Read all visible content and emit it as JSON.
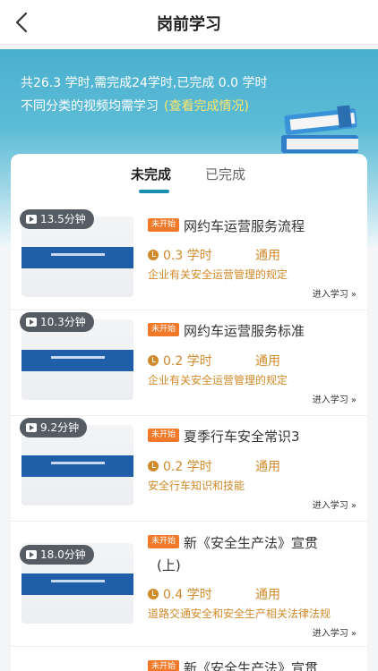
{
  "nav": {
    "title": "岗前学习"
  },
  "banner": {
    "summary": "共26.3 学时,需完成24学时,已完成 0.0 学时",
    "note": "不同分类的视频均需学习",
    "link": "(查看完成情况)"
  },
  "tabs": [
    {
      "label": "未完成"
    },
    {
      "label": "已完成"
    }
  ],
  "courses": [
    {
      "duration": "13.5分钟",
      "status": "未开始",
      "title": "网约车运营服务流程",
      "title2": "",
      "hours": "0.3 学时",
      "category": "通用",
      "desc": "企业有关安全运营管理的规定",
      "enter": "进入学习 »"
    },
    {
      "duration": "10.3分钟",
      "status": "未开始",
      "title": "网约车运营服务标准",
      "title2": "",
      "hours": "0.2 学时",
      "category": "通用",
      "desc": "企业有关安全运营管理的规定",
      "enter": "进入学习 »"
    },
    {
      "duration": "9.2分钟",
      "status": "未开始",
      "title": "夏季行车安全常识3",
      "title2": "",
      "hours": "0.2 学时",
      "category": "通用",
      "desc": "安全行车知识和技能",
      "enter": "进入学习 »"
    },
    {
      "duration": "18.0分钟",
      "status": "未开始",
      "title": "新《安全生产法》宣贯",
      "title2": "(上)",
      "hours": "0.4 学时",
      "category": "通用",
      "desc": "道路交通安全和安全生产相关法律法规",
      "enter": "进入学习 »"
    },
    {
      "duration": "",
      "status": "未开始",
      "title": "新《安全生产法》宣贯",
      "title2": "",
      "hours": "",
      "category": "",
      "desc": "",
      "enter": ""
    }
  ]
}
